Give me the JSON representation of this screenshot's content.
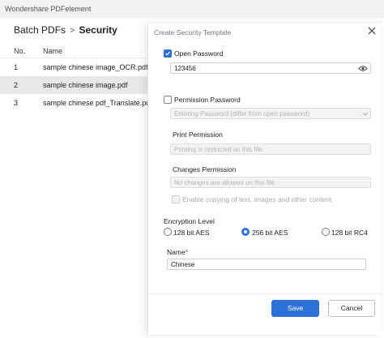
{
  "app": {
    "title": "Wondershare PDFelement"
  },
  "breadcrumb": {
    "parent": "Batch PDFs",
    "separator": ">",
    "current": "Security"
  },
  "table": {
    "headers": {
      "no": "No.",
      "name": "Name"
    },
    "rows": [
      {
        "no": "1",
        "name": "sample chinese image_OCR.pdf"
      },
      {
        "no": "2",
        "name": "sample chinese image.pdf"
      },
      {
        "no": "3",
        "name": "sample chinese pdf_Translate.pdf"
      }
    ],
    "selected_row": 2
  },
  "dialog": {
    "title": "Create Security Template",
    "open_password": {
      "label": "Open Password",
      "checked": true,
      "value": "123456"
    },
    "permission_password": {
      "label": "Permission Password",
      "checked": false,
      "placeholder": "Entering Password (differ from open password)"
    },
    "print_permission": {
      "label": "Print Permission",
      "value": "Printing is restricted on this file."
    },
    "changes_permission": {
      "label": "Changes Permission",
      "value": "No changes are allowed on this file."
    },
    "enable_copying": {
      "label": "Enable copying of text, images and other content",
      "checked": false
    },
    "encryption": {
      "label": "Encryption Level",
      "options": [
        "128 bit AES",
        "256 bit AES",
        "128 bit RC4"
      ],
      "selected": "256 bit AES"
    },
    "name": {
      "label": "Name",
      "required_mark": "*",
      "value": "Chinese"
    },
    "buttons": {
      "save": "Save",
      "cancel": "Cancel"
    }
  },
  "colors": {
    "accent": "#2f6fd8",
    "selected_row": "#e8e8e8"
  }
}
